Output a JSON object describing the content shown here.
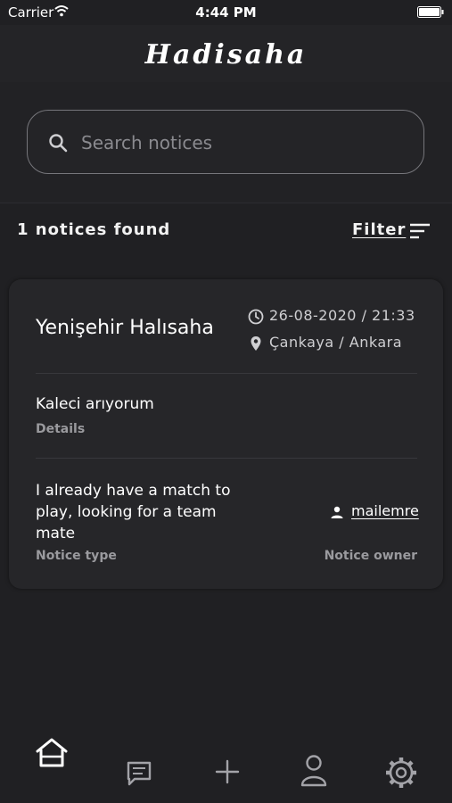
{
  "status_bar": {
    "carrier": "Carrier",
    "time": "4:44 PM"
  },
  "header": {
    "title": "Hadisaha"
  },
  "search": {
    "placeholder": "Search notices",
    "value": ""
  },
  "results": {
    "count_text": "1 notices found",
    "filter_label": "Filter"
  },
  "notices": [
    {
      "title": "Yenişehir Halısaha",
      "datetime": "26-08-2020 / 21:33",
      "location": "Çankaya / Ankara",
      "details_value": "Kaleci arıyorum",
      "details_caption": "Details",
      "type_value": "I already have a match to play, looking for a team mate",
      "type_caption": "Notice type",
      "owner_value": "mailemre",
      "owner_caption": "Notice owner"
    }
  ],
  "tab_bar": {
    "tabs": [
      {
        "icon": "home-icon",
        "active": true
      },
      {
        "icon": "chat-icon",
        "active": false
      },
      {
        "icon": "add-icon",
        "active": false
      },
      {
        "icon": "profile-icon",
        "active": false
      },
      {
        "icon": "settings-icon",
        "active": false
      }
    ]
  },
  "colors": {
    "background": "#202023",
    "card": "#262629",
    "text": "#ffffff",
    "muted": "#9a9a9e"
  }
}
